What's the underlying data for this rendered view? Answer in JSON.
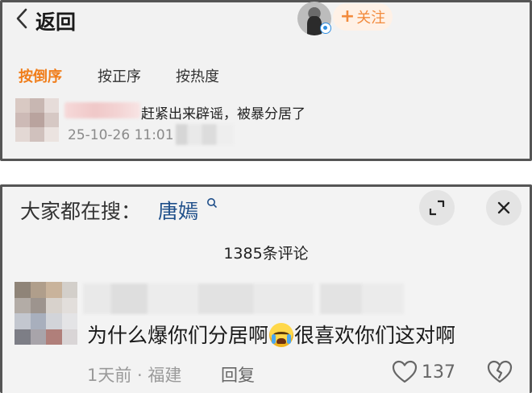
{
  "top_panel": {
    "back_label": "返回",
    "follow_label": "关注",
    "sort_tabs": [
      {
        "label": "按倒序",
        "active": true
      },
      {
        "label": "按正序",
        "active": false
      },
      {
        "label": "按热度",
        "active": false
      }
    ],
    "comment": {
      "text": "赶紧出来辟谣，被暴分居了",
      "time": "25-10-26 11:01"
    }
  },
  "bottom_panel": {
    "search_hint_label": "大家都在搜：",
    "search_hint_term": "唐嫣",
    "comment_count": "1385条评论",
    "comment": {
      "text_before": "为什么爆你们分居啊",
      "text_after": "很喜欢你们这对啊",
      "emoji": "crying-face-icon",
      "time_location": "1天前 · 福建",
      "reply_label": "回复",
      "like_count": "137"
    }
  },
  "colors": {
    "accent_orange": "#f07d1a",
    "follow_orange": "#f28a3c",
    "link_blue": "#1f4f8a",
    "muted_gray": "#9a9a9a"
  }
}
